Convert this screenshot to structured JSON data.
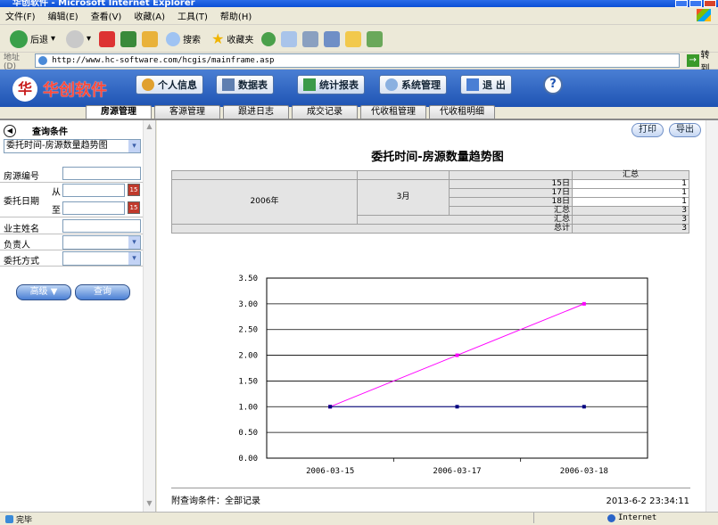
{
  "window": {
    "title": "华创软件 - Microsoft Internet Explorer"
  },
  "menu": [
    "文件(F)",
    "编辑(E)",
    "查看(V)",
    "收藏(A)",
    "工具(T)",
    "帮助(H)"
  ],
  "toolbar": {
    "back": "后退",
    "search": "搜索",
    "favorites": "收藏夹"
  },
  "address": {
    "label": "地址(D)",
    "url": "http://www.hc-software.com/hcgis/mainframe.asp",
    "go": "转到"
  },
  "app": {
    "logo": "华创软件",
    "nav": [
      "个人信息",
      "数据表",
      "统计报表",
      "系统管理",
      "退 出"
    ],
    "help": "?"
  },
  "tabs": [
    "房源管理",
    "客源管理",
    "跟进日志",
    "成交记录",
    "代收租管理",
    "代收租明细"
  ],
  "sidebar": {
    "header": "查询条件",
    "report_select": "委托时间-房源数量趋势图",
    "fields": {
      "house_no": "房源编号",
      "entrust_date": "委托日期",
      "from": "从",
      "to": "至",
      "owner": "业主姓名",
      "manager": "负责人",
      "entrust_mode": "委托方式"
    },
    "advanced": "高级 ▼",
    "query": "查询"
  },
  "main": {
    "print": "打印",
    "export": "导出",
    "title": "委托时间-房源数量趋势图",
    "table": {
      "summary": "汇总",
      "year": "2006年",
      "month": "3月",
      "days": [
        {
          "day": "15日",
          "value": "1"
        },
        {
          "day": "17日",
          "value": "1"
        },
        {
          "day": "18日",
          "value": "1"
        }
      ],
      "month_total_label": "汇总",
      "month_total": "3",
      "year_total_label": "汇总",
      "year_total": "3",
      "grand_total_label": "总计",
      "grand_total": "3"
    },
    "footer_left": "附查询条件：全部记录",
    "footer_right": "2013-6-2 23:34:11"
  },
  "chart_data": {
    "type": "line",
    "categories": [
      "2006-03-15",
      "2006-03-17",
      "2006-03-18"
    ],
    "y_ticks": [
      "3.50",
      "3.00",
      "2.50",
      "2.00",
      "1.50",
      "1.00",
      "0.50",
      "0.00"
    ],
    "ylim": [
      0,
      3.5
    ],
    "grid": true,
    "series": [
      {
        "values": [
          1,
          2,
          3
        ],
        "color": "#ff00ff"
      },
      {
        "values": [
          1,
          1,
          1
        ],
        "color": "#000080"
      }
    ]
  },
  "status": {
    "done": "完毕",
    "zone": "Internet"
  }
}
